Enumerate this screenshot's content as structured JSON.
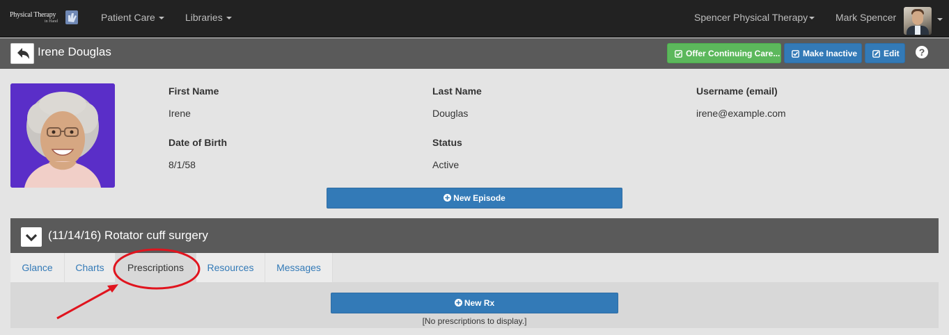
{
  "nav": {
    "logo_line1": "Physical Therapy",
    "logo_line2": "in Hand",
    "menu": [
      {
        "label": "Patient Care"
      },
      {
        "label": "Libraries"
      }
    ],
    "clinic": "Spencer Physical Therapy",
    "user": "Mark Spencer"
  },
  "header": {
    "patient_name": "Irene Douglas",
    "actions": {
      "offer": "Offer Continuing Care...",
      "inactive": "Make Inactive",
      "edit": "Edit"
    },
    "help": "?"
  },
  "patient": {
    "first_name_label": "First Name",
    "first_name": "Irene",
    "last_name_label": "Last Name",
    "last_name": "Douglas",
    "username_label": "Username (email)",
    "username": "irene@example.com",
    "dob_label": "Date of Birth",
    "dob": "8/1/58",
    "status_label": "Status",
    "status": "Active"
  },
  "new_episode_label": "New Episode",
  "episode": {
    "title": "(11/14/16) Rotator cuff surgery",
    "tabs": [
      {
        "label": "Glance"
      },
      {
        "label": "Charts"
      },
      {
        "label": "Prescriptions",
        "active": true
      },
      {
        "label": "Resources"
      },
      {
        "label": "Messages"
      }
    ],
    "new_rx_label": "New Rx",
    "empty_message": "[No prescriptions to display.]"
  },
  "colors": {
    "navbar": "#222222",
    "titlebar": "#5a5a5a",
    "primary": "#337ab7",
    "success": "#5cb85c",
    "annotation": "#e0141e"
  }
}
